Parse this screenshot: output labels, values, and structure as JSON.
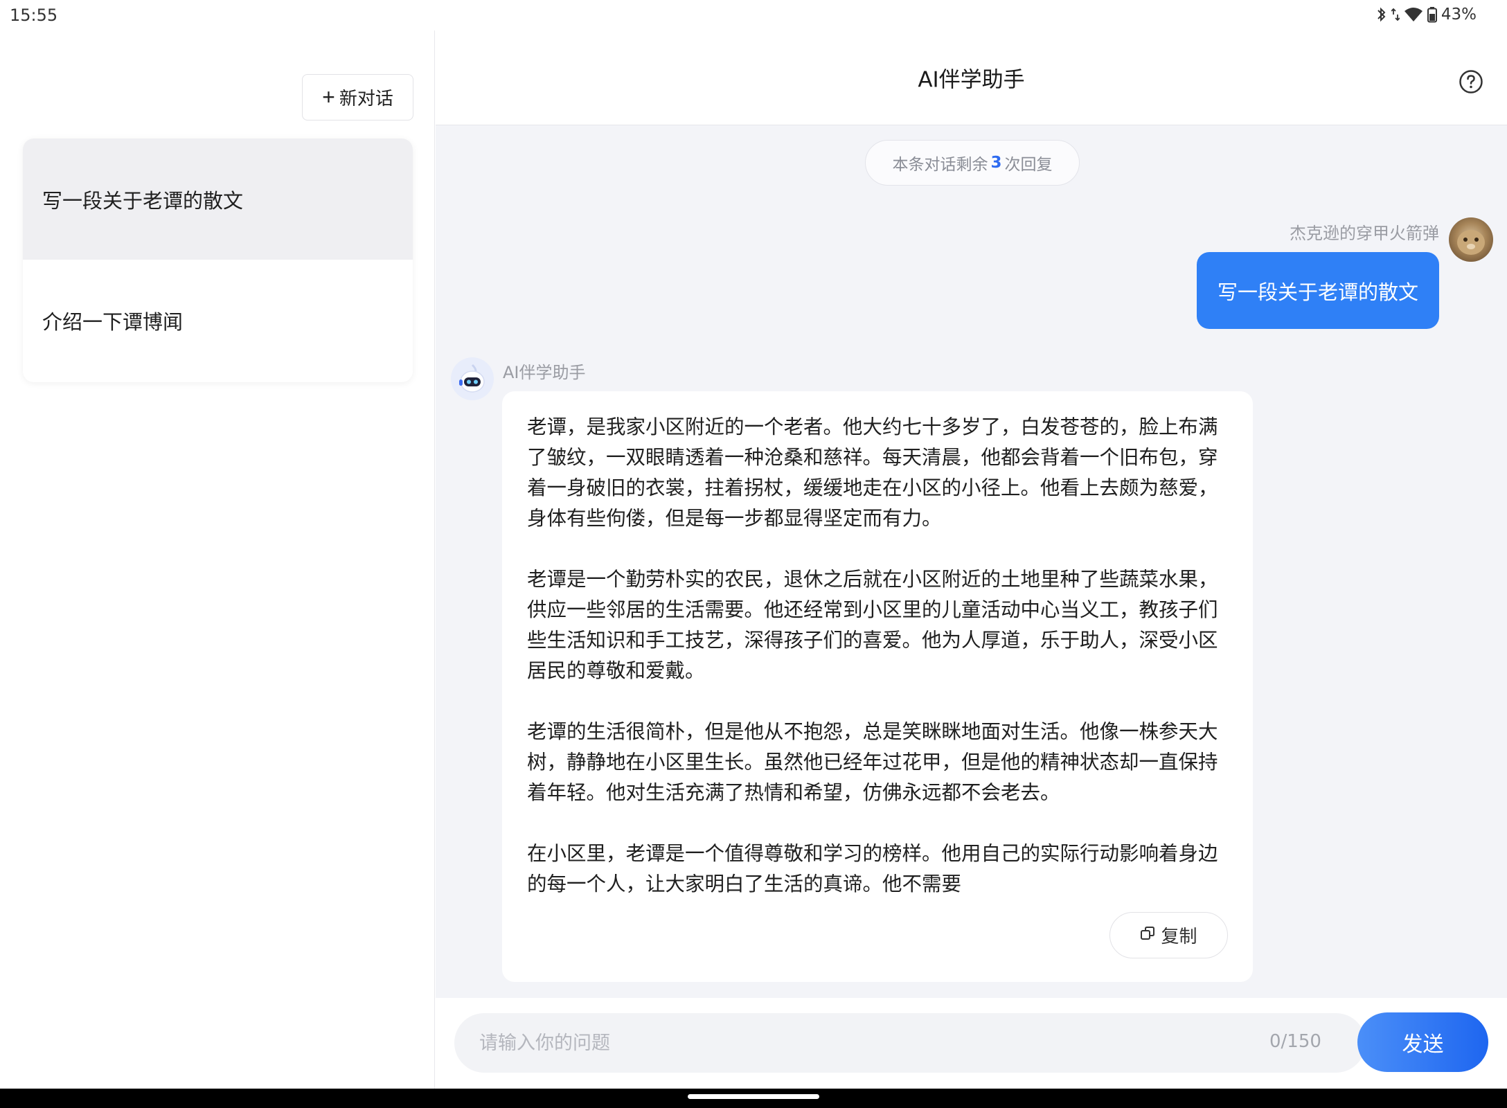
{
  "status_bar": {
    "time": "15:55",
    "battery": "43%",
    "icons": [
      "bluetooth-icon",
      "data-arrows-icon",
      "wifi-icon",
      "battery-icon"
    ]
  },
  "sidebar": {
    "new_chat_label": "新对话",
    "history": [
      {
        "title": "写一段关于老谭的散文",
        "active": true
      },
      {
        "title": "介绍一下谭博闻",
        "active": false
      }
    ]
  },
  "header": {
    "title": "AI伴学助手",
    "help_icon": "help-circle-icon"
  },
  "conversation": {
    "quota_prefix": "本条对话剩余",
    "quota_count": "3",
    "quota_suffix": "次回复",
    "user": {
      "name": "杰克逊的穿甲火箭弹",
      "message": "写一段关于老谭的散文"
    },
    "assistant": {
      "name": "AI伴学助手",
      "paragraphs": [
        "老谭，是我家小区附近的一个老者。他大约七十多岁了，白发苍苍的，脸上布满了皱纹，一双眼睛透着一种沧桑和慈祥。每天清晨，他都会背着一个旧布包，穿着一身破旧的衣裳，拄着拐杖，缓缓地走在小区的小径上。他看上去颇为慈爱，身体有些佝偻，但是每一步都显得坚定而有力。",
        "老谭是一个勤劳朴实的农民，退休之后就在小区附近的土地里种了些蔬菜水果，供应一些邻居的生活需要。他还经常到小区里的儿童活动中心当义工，教孩子们些生活知识和手工技艺，深得孩子们的喜爱。他为人厚道，乐于助人，深受小区居民的尊敬和爱戴。",
        "老谭的生活很简朴，但是他从不抱怨，总是笑眯眯地面对生活。他像一株参天大树，静静地在小区里生长。虽然他已经年过花甲，但是他的精神状态却一直保持着年轻。他对生活充满了热情和希望，仿佛永远都不会老去。",
        "在小区里，老谭是一个值得尊敬和学习的榜样。他用自己的实际行动影响着身边的每一个人，让大家明白了生活的真谛。他不需要"
      ],
      "copy_label": "复制"
    }
  },
  "composer": {
    "placeholder": "请输入你的问题",
    "value": "",
    "counter": "0/150",
    "send_label": "发送"
  },
  "colors": {
    "accent": "#2f80f6",
    "background": "#f3f4f8",
    "quota_number": "#2f6bf0"
  }
}
